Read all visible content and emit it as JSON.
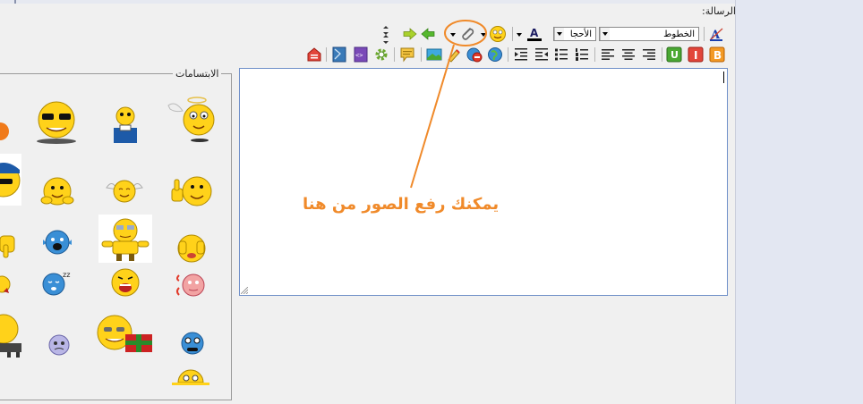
{
  "form": {
    "message_label": "الرسالة:"
  },
  "toolbar": {
    "font_combo": "الخطوط",
    "size_combo": "الأحجا",
    "font_color_glyph": "A",
    "remove_format_glyph": "A"
  },
  "editor": {
    "content": ""
  },
  "annotation": {
    "text": "يمكنك رفع الصور من هنا",
    "color": "#f08a2a"
  },
  "smilies": {
    "legend": "الابتسامات",
    "items": [
      "angel-smiley",
      "glasses-smiley",
      "moneybag-smiley",
      "wave-smiley",
      "thumbs-up-smiley",
      "angel-wings-smiley",
      "hugging-smiley",
      "cap-smiley",
      "embarrassed-smiley",
      "pointing-bear-smiley",
      "crying-smiley",
      "thumb-down-smiley",
      "shy-smiley",
      "scared-smiley",
      "sleepy-smiley",
      "devil-smiley",
      "blue-smiley",
      "gift-smiley",
      "sad-purple-smiley",
      "music-smiley",
      "peeking-smiley"
    ]
  },
  "colors": {
    "accent_orange": "#f08a2a",
    "editor_border": "#6f8fc8",
    "panel_bg": "#f0f0f0"
  }
}
